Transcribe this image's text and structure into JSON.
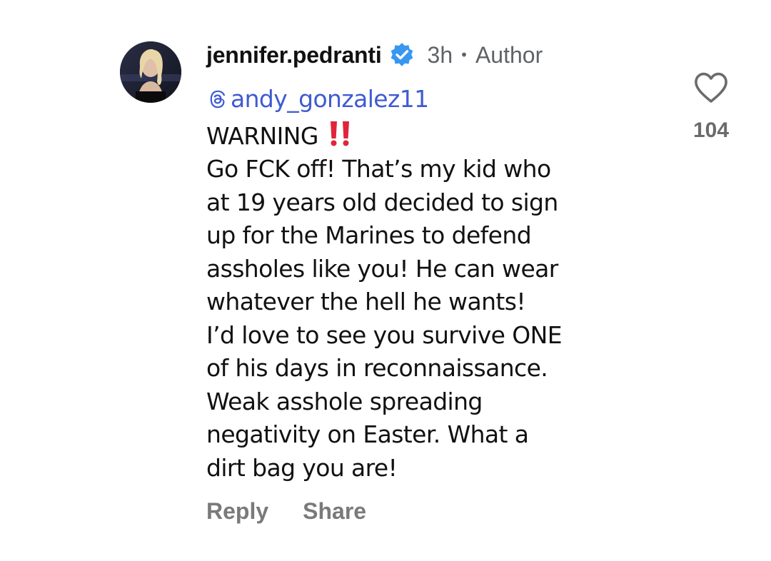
{
  "comment": {
    "username": "jennifer.pedranti",
    "verified": true,
    "time": "3h",
    "separator": "•",
    "role": "Author",
    "mention": "@andy_gonzalez11",
    "mention_text": "andy_gonzalez11",
    "lines": [
      "WARNING",
      "Go FCK off! That’s my kid who",
      "at 19 years old  decided to sign",
      "up for the Marines to defend",
      "assholes like you! He can wear",
      "whatever the hell he wants!",
      "I’d love to see you survive ONE",
      "of his days in reconnaissance.",
      "Weak asshole spreading",
      "negativity on Easter.  What a",
      "dirt bag you are!"
    ],
    "emoji": "double-exclamation-mark"
  },
  "actions": {
    "reply_label": "Reply",
    "share_label": "Share"
  },
  "like": {
    "icon": "heart-icon",
    "count": "104"
  },
  "colors": {
    "mention": "#3f5bd1",
    "verified_badge": "#3897f0",
    "muted_text": "#5f6368",
    "action_text": "#7a7a7a",
    "emoji_red": "#e0243a"
  }
}
